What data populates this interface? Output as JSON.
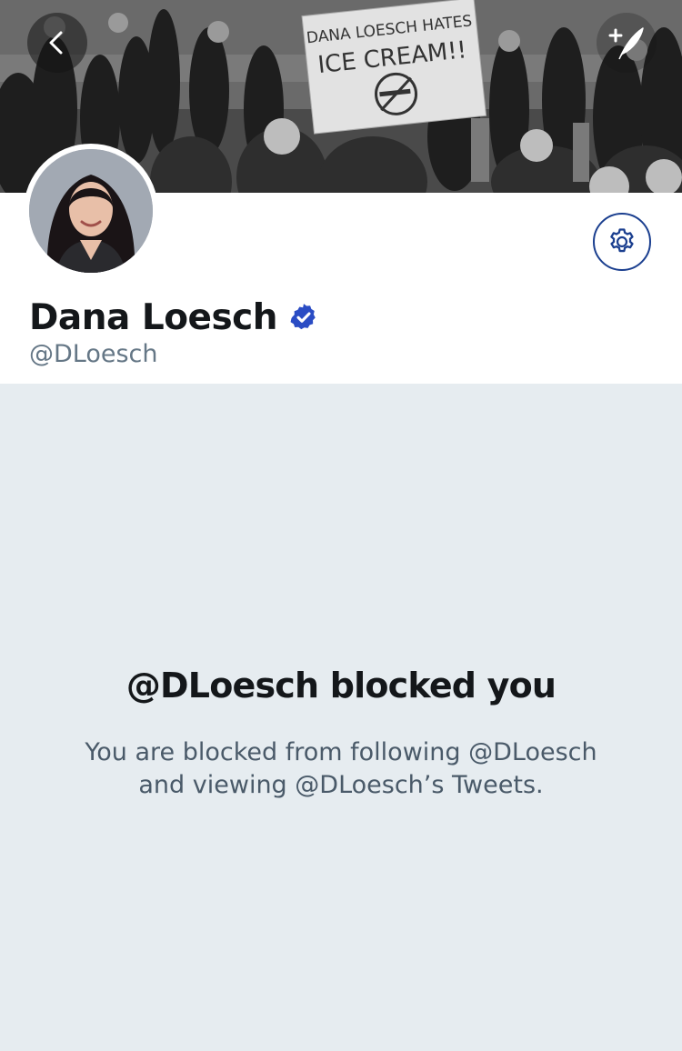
{
  "banner": {
    "sign_line1": "DANA LOESCH HATES",
    "sign_line2": "ICE CREAM!!"
  },
  "nav": {
    "back_icon": "chevron-left-icon",
    "compose_icon": "compose-tweet-icon"
  },
  "profile": {
    "display_name": "Dana Loesch",
    "handle": "@DLoesch",
    "verified": true,
    "verified_icon": "verified-badge-icon",
    "settings_icon": "gear-icon"
  },
  "blocked": {
    "title": "@DLoesch blocked you",
    "line1": "You are blocked from following @DLoesch",
    "line2": "and viewing @DLoesch’s Tweets."
  },
  "colors": {
    "accent": "#1b3f8f",
    "verified": "#2a4cc4",
    "background": "#e6ecf0",
    "text_primary": "#14171a",
    "text_secondary": "#657786"
  }
}
